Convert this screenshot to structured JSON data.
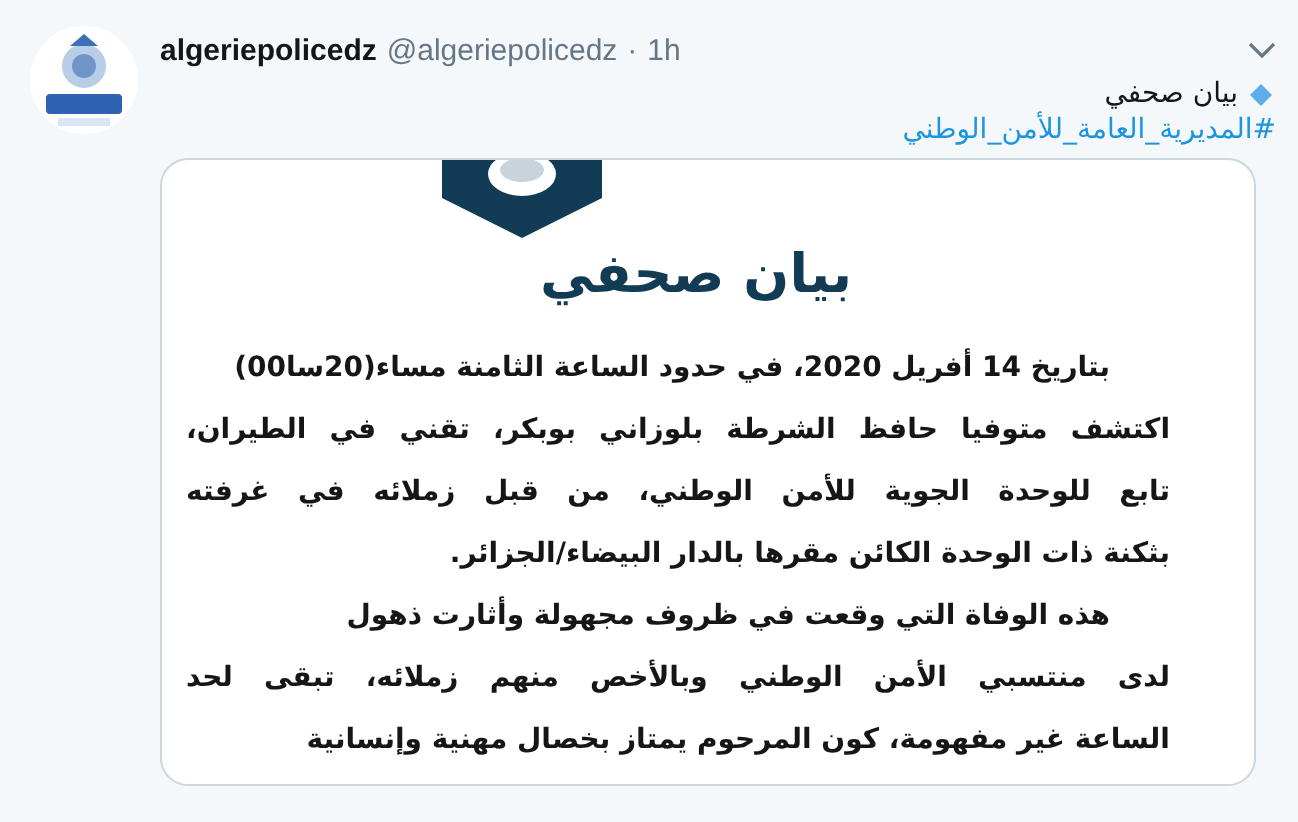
{
  "tweet": {
    "author_name": "algeriepolicedz",
    "handle": "@algeriepolicedz",
    "separator": "·",
    "time": "1h",
    "text": "بيان صحفي",
    "hashtag": "#المديرية_العامة_للأمن_الوطني",
    "document": {
      "title": "بيان صحفي",
      "paragraphs": [
        {
          "lines": [
            "بتاريخ 14 أفريل 2020، في حدود الساعة الثامنة مساء(20سا00)",
            "اكتشف متوفيا حافظ الشرطة بلوزاني بوبكر، تقني في الطيران،",
            "تابع للوحدة الجوية للأمن الوطني، من قبل زملائه في غرفته",
            "بثكنة ذات الوحدة الكائن مقرها بالدار البيضاء/الجزائر."
          ]
        },
        {
          "lines": [
            "هذه الوفاة التي وقعت في ظروف مجهولة وأثارت ذهول",
            "لدى منتسبي الأمن الوطني وبالأخص منهم زملائه، تبقى لحد",
            "الساعة غير مفهومة، كون المرحوم يمتاز بخصال مهنية وإنسانية"
          ]
        }
      ]
    }
  }
}
